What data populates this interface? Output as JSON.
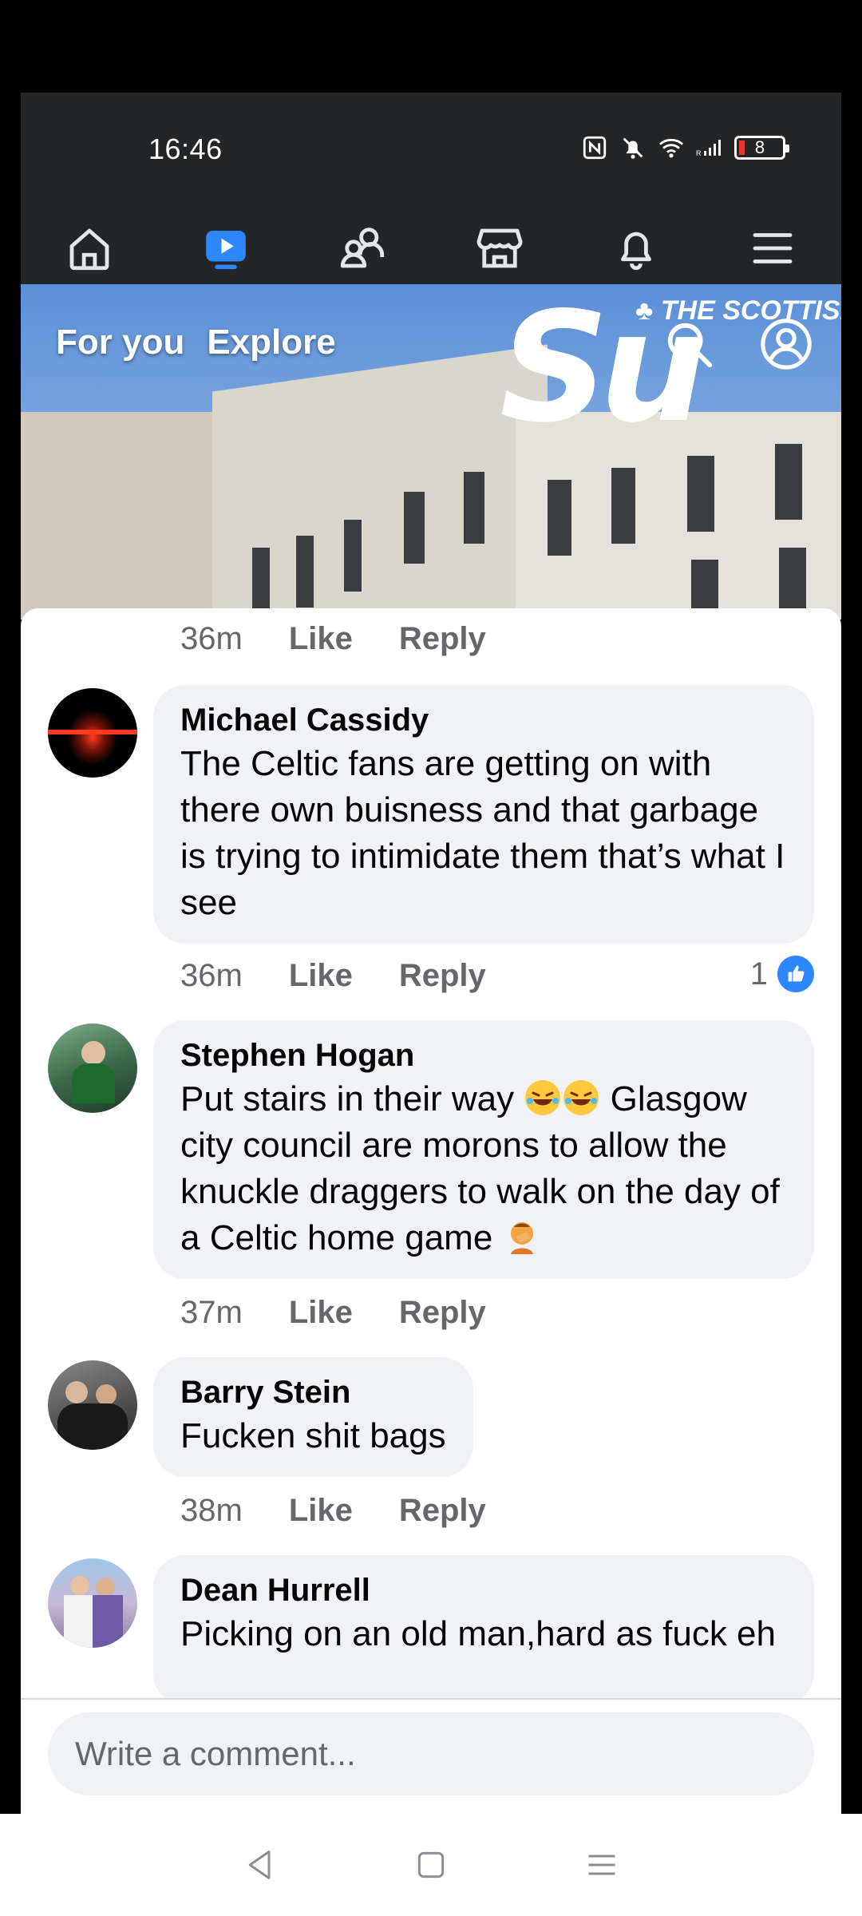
{
  "status": {
    "time": "16:46",
    "battery": "8",
    "icons": [
      "nfc-icon",
      "mute-icon",
      "wifi-icon",
      "signal-icon",
      "battery-icon"
    ]
  },
  "nav": {
    "items": [
      "home-icon",
      "video-icon",
      "friends-icon",
      "marketplace-icon",
      "notifications-icon",
      "menu-icon"
    ],
    "active": "video-icon"
  },
  "video": {
    "tabs": [
      "For you",
      "Explore"
    ],
    "logo_text": "Su",
    "logo_tag": "♣ THE SCOTTISH"
  },
  "comments": [
    {
      "time": "36m",
      "like": "Like",
      "reply": "Reply"
    },
    {
      "author": "Michael Cassidy",
      "text": "The Celtic fans are getting on with there own buisness and that garbage is trying to intimidate them that’s what I see",
      "time": "36m",
      "like": "Like",
      "reply": "Reply",
      "reactions": "1"
    },
    {
      "author": "Stephen Hogan",
      "text_1": "Put stairs in their way",
      "text_2": "Glasgow city council are morons to allow the knuckle draggers to walk on the day of a Celtic home game",
      "time": "37m",
      "like": "Like",
      "reply": "Reply"
    },
    {
      "author": "Barry Stein",
      "text": "Fucken shit bags",
      "time": "38m",
      "like": "Like",
      "reply": "Reply"
    },
    {
      "author": "Dean Hurrell",
      "text": "Picking on an old man,hard as fuck eh"
    }
  ],
  "composer": {
    "placeholder": "Write a comment..."
  },
  "colors": {
    "accent": "#2d88ff",
    "bubble": "#f0f2f5",
    "dark_bar": "#242526"
  }
}
